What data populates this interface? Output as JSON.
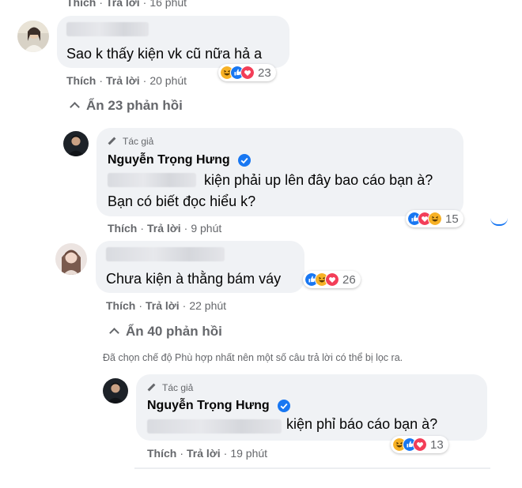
{
  "comments": [
    {
      "actions": {
        "like": "Thích",
        "reply": "Trả lời",
        "time": "16 phút"
      }
    },
    {
      "text": "Sao k thấy kiện vk cũ nữa hả a",
      "actions": {
        "like": "Thích",
        "reply": "Trả lời",
        "time": "20 phút"
      },
      "reaction_count": "23",
      "reactions": [
        "haha",
        "like",
        "love"
      ],
      "toggle": "Ẩn 23 phản hồi"
    },
    {
      "author_tag": "Tác giả",
      "author": "Nguyễn Trọng Hưng",
      "line1": "kiện phải up lên đây bao cáo bạn à?",
      "line2": "Bạn có biết đọc hiểu k?",
      "actions": {
        "like": "Thích",
        "reply": "Trả lời",
        "time": "9 phút"
      },
      "reaction_count": "15",
      "reactions": [
        "like",
        "love",
        "haha"
      ]
    },
    {
      "text": "Chưa kiện à thằng bám váy",
      "actions": {
        "like": "Thích",
        "reply": "Trả lời",
        "time": "22 phút"
      },
      "reaction_count": "26",
      "reactions": [
        "like",
        "haha",
        "love"
      ],
      "toggle": "Ẩn 40 phản hồi",
      "notice": "Đã chọn chế độ Phù hợp nhất nên một số câu trả lời có thể bị lọc ra."
    },
    {
      "author_tag": "Tác giả",
      "author": "Nguyễn Trọng Hưng",
      "line1": "kiện phỉ báo cáo bạn à?",
      "actions": {
        "like": "Thích",
        "reply": "Trả lời",
        "time": "19 phút"
      },
      "reaction_count": "13",
      "reactions": [
        "haha",
        "like",
        "love"
      ]
    }
  ],
  "colors": {
    "like": "#1877f2",
    "love": "#f33e58",
    "haha": "#f7b125",
    "bubble": "#f0f2f5",
    "meta": "#65676b"
  }
}
